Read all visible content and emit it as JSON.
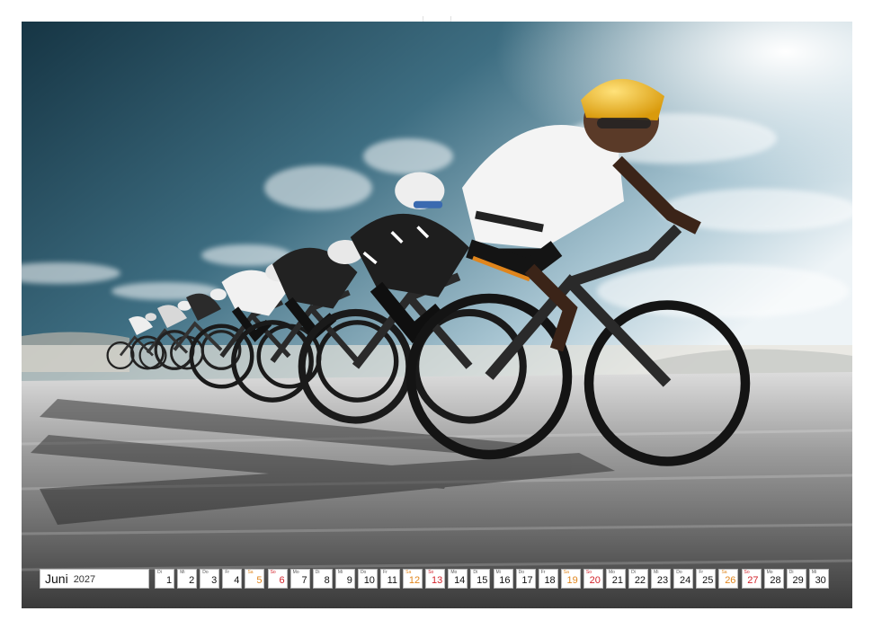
{
  "calendar": {
    "month": "Juni",
    "year": "2027",
    "days": [
      {
        "wd": "Di",
        "num": "1",
        "type": "weekday"
      },
      {
        "wd": "Mi",
        "num": "2",
        "type": "weekday"
      },
      {
        "wd": "Do",
        "num": "3",
        "type": "weekday"
      },
      {
        "wd": "Fr",
        "num": "4",
        "type": "weekday"
      },
      {
        "wd": "Sa",
        "num": "5",
        "type": "sat"
      },
      {
        "wd": "So",
        "num": "6",
        "type": "sun"
      },
      {
        "wd": "Mo",
        "num": "7",
        "type": "weekday"
      },
      {
        "wd": "Di",
        "num": "8",
        "type": "weekday"
      },
      {
        "wd": "Mi",
        "num": "9",
        "type": "weekday"
      },
      {
        "wd": "Do",
        "num": "10",
        "type": "weekday"
      },
      {
        "wd": "Fr",
        "num": "11",
        "type": "weekday"
      },
      {
        "wd": "Sa",
        "num": "12",
        "type": "sat"
      },
      {
        "wd": "So",
        "num": "13",
        "type": "sun"
      },
      {
        "wd": "Mo",
        "num": "14",
        "type": "weekday"
      },
      {
        "wd": "Di",
        "num": "15",
        "type": "weekday"
      },
      {
        "wd": "Mi",
        "num": "16",
        "type": "weekday"
      },
      {
        "wd": "Do",
        "num": "17",
        "type": "weekday"
      },
      {
        "wd": "Fr",
        "num": "18",
        "type": "weekday"
      },
      {
        "wd": "Sa",
        "num": "19",
        "type": "sat"
      },
      {
        "wd": "So",
        "num": "20",
        "type": "sun"
      },
      {
        "wd": "Mo",
        "num": "21",
        "type": "weekday"
      },
      {
        "wd": "Di",
        "num": "22",
        "type": "weekday"
      },
      {
        "wd": "Mi",
        "num": "23",
        "type": "weekday"
      },
      {
        "wd": "Do",
        "num": "24",
        "type": "weekday"
      },
      {
        "wd": "Fr",
        "num": "25",
        "type": "weekday"
      },
      {
        "wd": "Sa",
        "num": "26",
        "type": "sat"
      },
      {
        "wd": "So",
        "num": "27",
        "type": "sun"
      },
      {
        "wd": "Mo",
        "num": "28",
        "type": "weekday"
      },
      {
        "wd": "Di",
        "num": "29",
        "type": "weekday"
      },
      {
        "wd": "Mi",
        "num": "30",
        "type": "weekday"
      }
    ]
  },
  "colors": {
    "saturday": "#e0851c",
    "sunday": "#d2222a",
    "sky_top": "#163544",
    "helmet": "#f2b51a"
  }
}
